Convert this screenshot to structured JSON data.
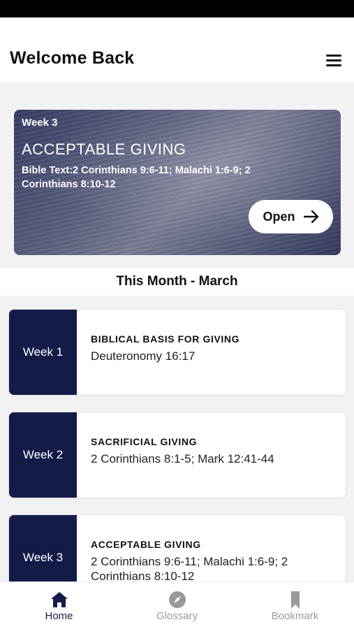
{
  "header": {
    "title": "Welcome Back",
    "menu_icon": "hamburger-menu-icon"
  },
  "banner": {
    "week": "Week 3",
    "title": "ACCEPTABLE GIVING",
    "bible_text": "Bible Text:2 Corinthians 9:6-11; Malachi 1:6-9; 2 Corinthians 8:10-12",
    "open_label": "Open",
    "open_icon": "arrow-right-icon"
  },
  "section": {
    "title": "This Month - March"
  },
  "weeks": [
    {
      "week": "Week 1",
      "title": "BIBLICAL BASIS FOR GIVING",
      "reference": "Deuteronomy 16:17"
    },
    {
      "week": "Week 2",
      "title": "SACRIFICIAL GIVING",
      "reference": "2 Corinthians 8:1-5; Mark 12:41-44"
    },
    {
      "week": "Week 3",
      "title": "ACCEPTABLE GIVING",
      "reference": "2 Corinthians 9:6-11; Malachi 1:6-9; 2 Corinthians 8:10-12"
    }
  ],
  "tabs": [
    {
      "label": "Home",
      "icon": "home-icon",
      "active": true
    },
    {
      "label": "Glossary",
      "icon": "compass-icon",
      "active": false
    },
    {
      "label": "Bookmark",
      "icon": "bookmark-icon",
      "active": false
    }
  ],
  "colors": {
    "accent": "#151b48",
    "inactive": "#9a9a9a",
    "background": "#f2f2f3"
  }
}
